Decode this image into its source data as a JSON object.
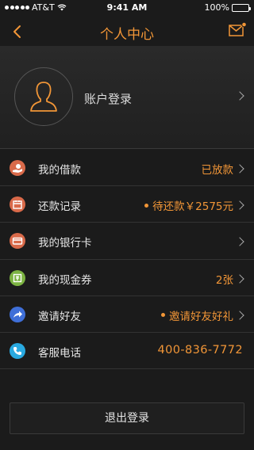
{
  "status_bar": {
    "carrier": "AT&T",
    "time": "9:41 AM",
    "battery": "100%"
  },
  "nav": {
    "title": "个人中心"
  },
  "profile": {
    "login_label": "账户登录"
  },
  "menu": [
    {
      "label": "我的借款",
      "value": "已放款",
      "icon": "hand-money-icon",
      "color": "#d96a4a"
    },
    {
      "label": "还款记录",
      "value": "待还款￥2575元",
      "icon": "calendar-icon",
      "color": "#d96a4a"
    },
    {
      "label": "我的银行卡",
      "value": "",
      "icon": "bank-card-icon",
      "color": "#d96a4a"
    },
    {
      "label": "我的现金券",
      "value": "2张",
      "icon": "coupon-icon",
      "color": "#7cb342"
    },
    {
      "label": "邀请好友",
      "value": "邀请好友好礼",
      "icon": "share-icon",
      "color": "#3f6fd8"
    },
    {
      "label": "客服电话",
      "value": "400-836-7772",
      "icon": "phone-icon",
      "color": "#29a9e0"
    }
  ],
  "logout_label": "退出登录",
  "colors": {
    "accent": "#f29637",
    "background": "#1b1b1b"
  }
}
